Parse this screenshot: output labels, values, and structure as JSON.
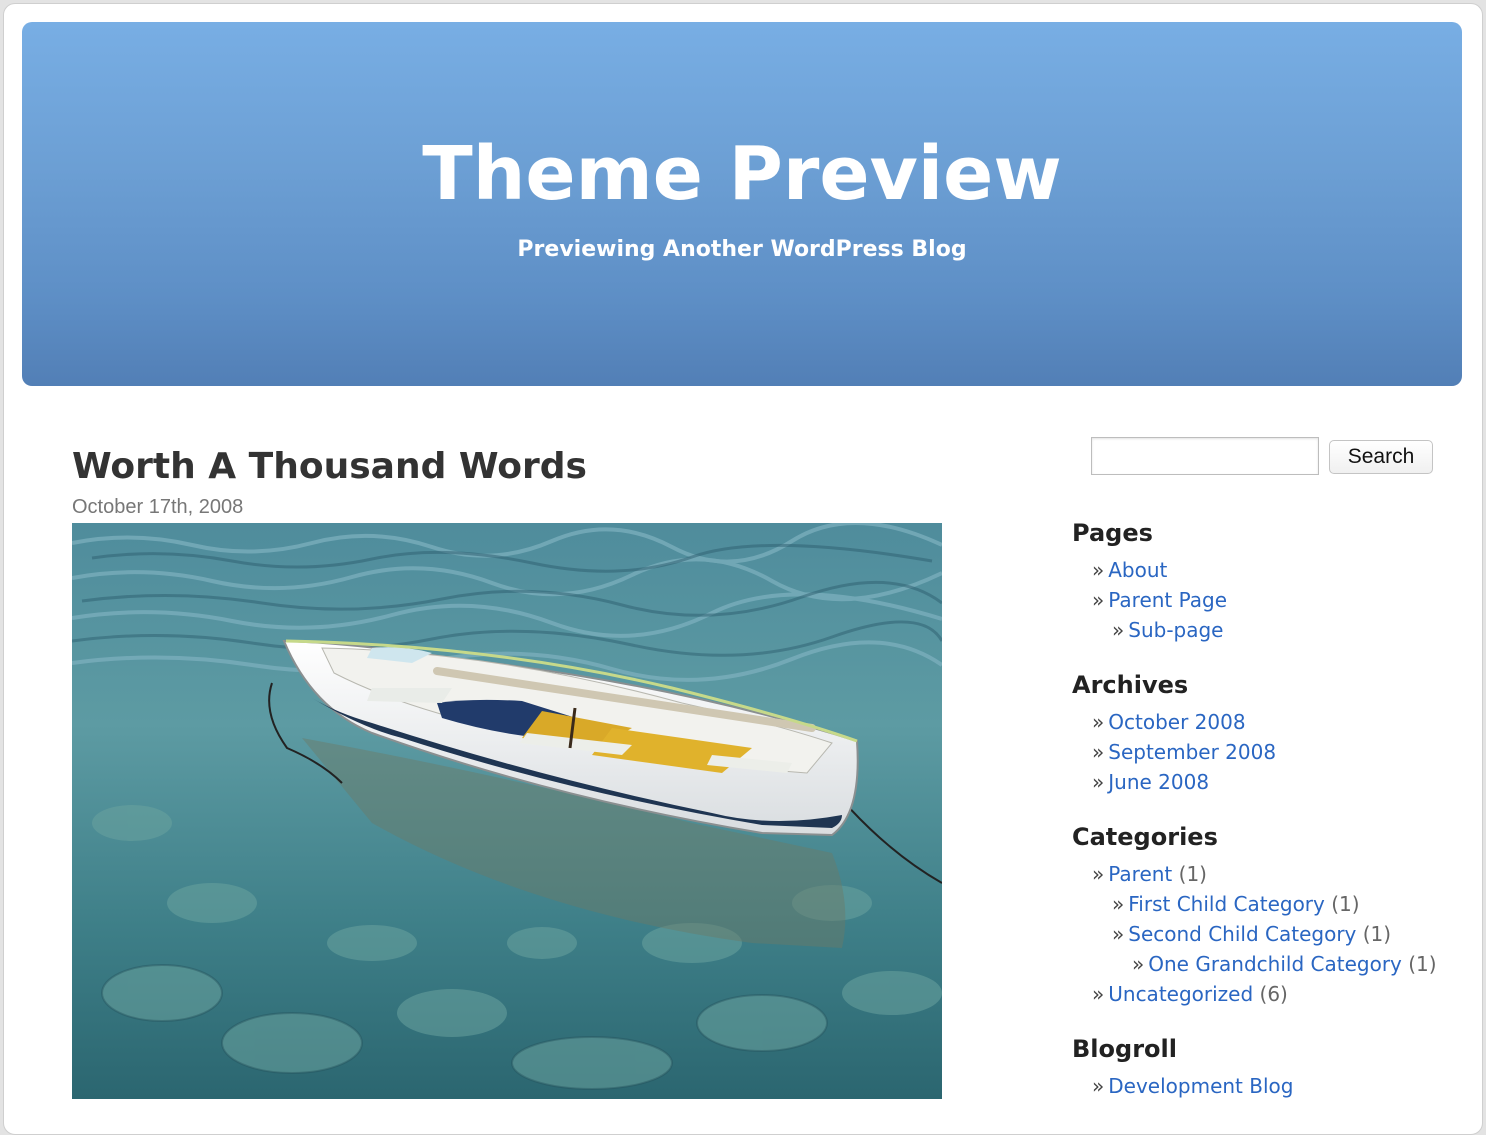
{
  "header": {
    "title": "Theme Preview",
    "subtitle": "Previewing Another WordPress Blog"
  },
  "post": {
    "title": "Worth A Thousand Words",
    "date": "October 17th, 2008",
    "image_alt": "boat-image"
  },
  "search": {
    "input_value": "",
    "button_label": "Search"
  },
  "sidebar": {
    "pages": {
      "title": "Pages",
      "items": [
        {
          "label": "About",
          "level": 0
        },
        {
          "label": "Parent Page",
          "level": 0
        },
        {
          "label": "Sub-page",
          "level": 1
        }
      ]
    },
    "archives": {
      "title": "Archives",
      "items": [
        {
          "label": "October 2008"
        },
        {
          "label": "September 2008"
        },
        {
          "label": "June 2008"
        }
      ]
    },
    "categories": {
      "title": "Categories",
      "items": [
        {
          "label": "Parent",
          "count": "(1)",
          "level": 0
        },
        {
          "label": "First Child Category",
          "count": "(1)",
          "level": 1
        },
        {
          "label": "Second Child Category",
          "count": "(1)",
          "level": 1
        },
        {
          "label": "One Grandchild Category",
          "count": "(1)",
          "level": 2
        },
        {
          "label": "Uncategorized",
          "count": "(6)",
          "level": 0
        }
      ]
    },
    "blogroll": {
      "title": "Blogroll",
      "items": [
        {
          "label": "Development Blog"
        }
      ]
    }
  },
  "colors": {
    "link": "#2a66c2",
    "header_top": "#78aee4",
    "header_bottom": "#527fb6"
  }
}
